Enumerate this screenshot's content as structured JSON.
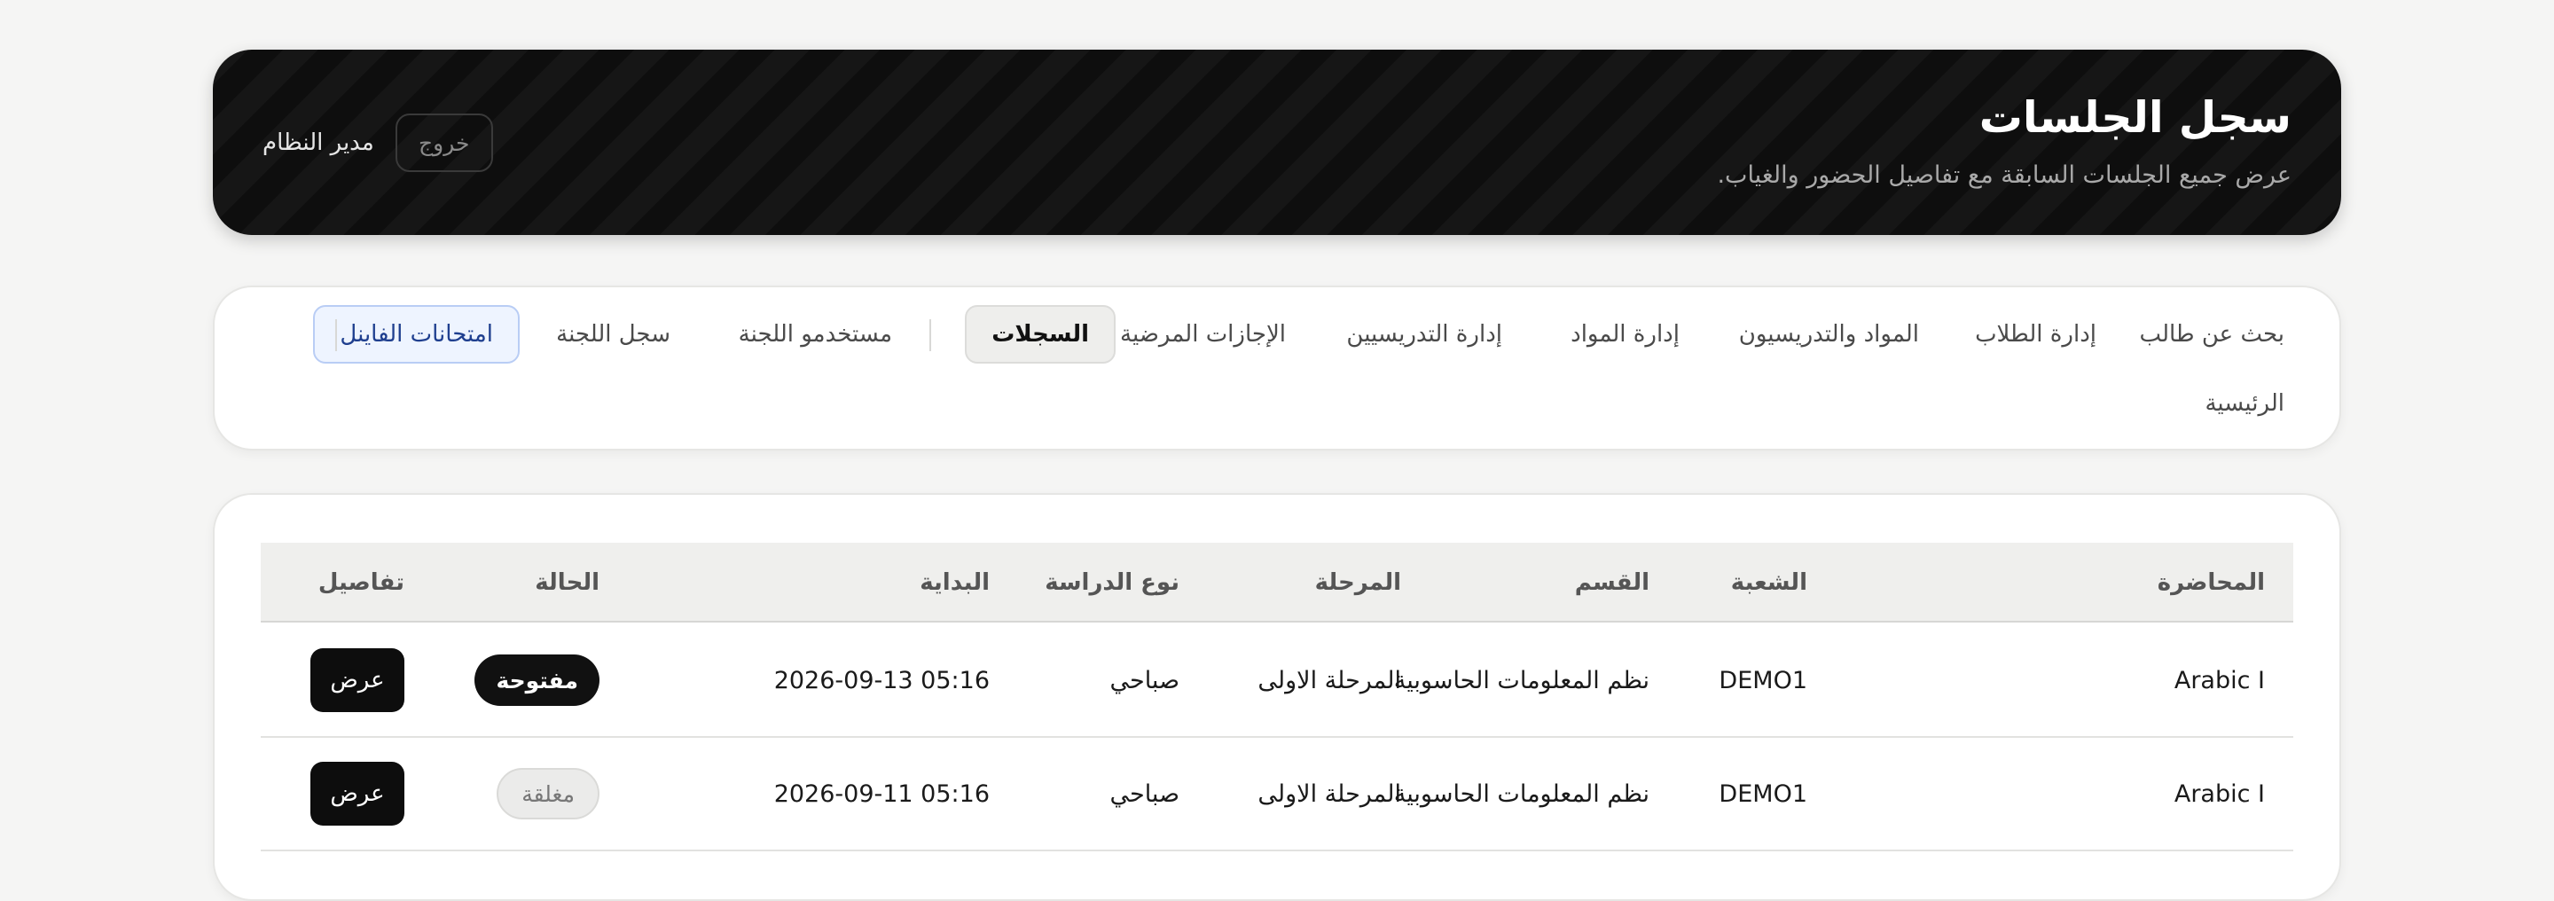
{
  "header": {
    "title": "سجل الجلسات",
    "subtitle": "عرض جميع الجلسات السابقة مع تفاصيل الحضور والغياب.",
    "user_name": "مدير النظام",
    "logout_label": "خروج"
  },
  "nav": {
    "items": [
      {
        "label": "بحث عن طالب"
      },
      {
        "label": "إدارة الطلاب"
      },
      {
        "label": "المواد والتدريسيون"
      },
      {
        "label": "إدارة المواد"
      },
      {
        "label": "إدارة التدريسيين"
      },
      {
        "label": "الإجازات المرضية"
      },
      {
        "label": "السجلات"
      },
      {
        "label": "مستخدمو اللجنة"
      },
      {
        "label": "سجل اللجنة"
      },
      {
        "label": "امتحانات الفاينل"
      },
      {
        "label": "الرئيسية"
      }
    ],
    "active": "السجلات"
  },
  "table": {
    "columns": [
      "المحاضرة",
      "الشعبة",
      "القسم",
      "المرحلة",
      "نوع الدراسة",
      "البداية",
      "الحالة",
      "تفاصيل"
    ],
    "rows": [
      {
        "lecture": "Arabic I",
        "section": "DEMO1",
        "department": "نظم المعلومات الحاسوبية",
        "stage": "المرحلة الاولى",
        "study_type": "صباحي",
        "start": "2026-09-13 05:16",
        "status": "مفتوحة",
        "action": "عرض"
      },
      {
        "lecture": "Arabic I",
        "section": "DEMO1",
        "department": "نظم المعلومات الحاسوبية",
        "stage": "المرحلة الاولى",
        "study_type": "صباحي",
        "start": "2026-09-11 05:16",
        "status": "مغلقة",
        "action": "عرض"
      }
    ]
  },
  "colors": {
    "header_bg": "#0e0e0e",
    "page_bg": "#f5f5f4",
    "accent_blue": "#1f3f8f",
    "badge_open": "#111111",
    "badge_closed": "#ebebea"
  }
}
